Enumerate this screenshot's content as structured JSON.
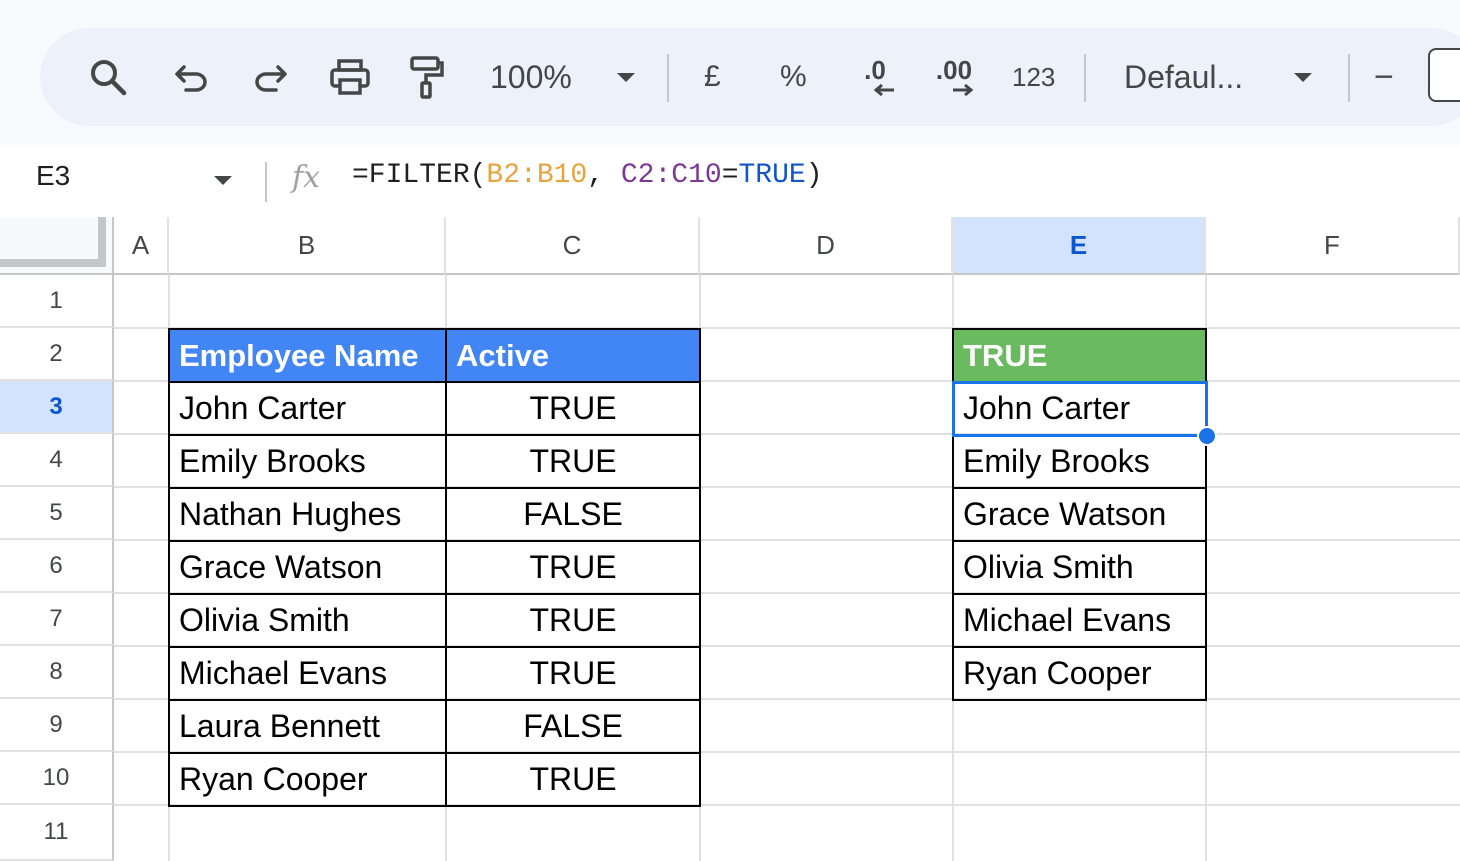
{
  "toolbar": {
    "zoom": "100%",
    "currency": "£",
    "percent": "%",
    "decrease_decimal": ".0",
    "increase_decimal": ".00",
    "number_format": "123",
    "font": "Defaul...",
    "font_size_minus": "−"
  },
  "formula_bar": {
    "name_box": "E3",
    "fx": "fx",
    "formula": {
      "prefix": "=FILTER(",
      "ref1": "B2:B10",
      "sep": ", ",
      "ref2": "C2:C10",
      "eq": "=",
      "value": "TRUE",
      "suffix": ")"
    }
  },
  "columns": [
    "A",
    "B",
    "C",
    "D",
    "E",
    "F"
  ],
  "rows": [
    "1",
    "2",
    "3",
    "4",
    "5",
    "6",
    "7",
    "8",
    "9",
    "10",
    "11"
  ],
  "table": {
    "headers": [
      "Employee Name",
      "Active"
    ],
    "names": [
      "John Carter",
      "Emily Brooks",
      "Nathan Hughes",
      "Grace Watson",
      "Olivia Smith",
      "Michael Evans",
      "Laura Bennett",
      "Ryan Cooper"
    ],
    "active": [
      "TRUE",
      "TRUE",
      "FALSE",
      "TRUE",
      "TRUE",
      "TRUE",
      "FALSE",
      "TRUE"
    ]
  },
  "result": {
    "header": "TRUE",
    "names": [
      "John Carter",
      "Emily Brooks",
      "Grace Watson",
      "Olivia Smith",
      "Michael Evans",
      "Ryan Cooper"
    ]
  },
  "selected_cell": "E3",
  "colors": {
    "header_blue": "#4285f4",
    "header_green": "#6aba5f",
    "selection": "#1a73e8",
    "ref1": "#e8a33d",
    "ref2": "#7e3794",
    "bool": "#1155cc"
  }
}
